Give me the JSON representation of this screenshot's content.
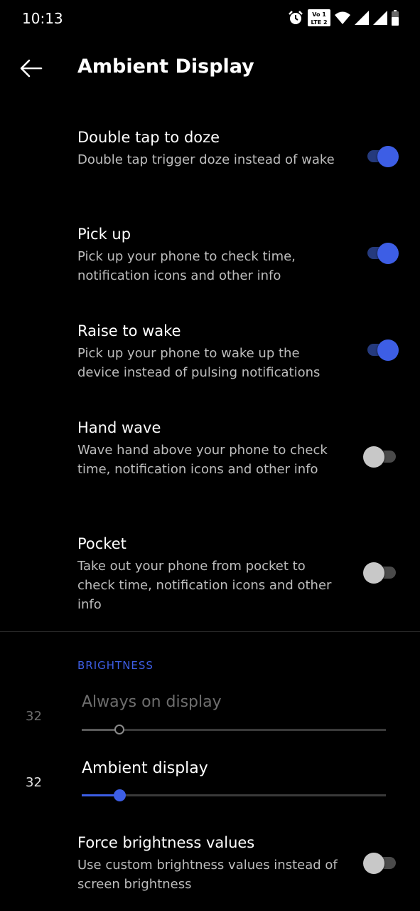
{
  "status_bar": {
    "time": "10:13",
    "icons": [
      "alarm-icon",
      "volte-icon",
      "wifi-icon",
      "signal-icon",
      "signal-icon-2",
      "battery-icon"
    ],
    "volte_text_top": "Vo 1",
    "volte_text_bottom": "LTE 2"
  },
  "header": {
    "title": "Ambient Display",
    "back_icon": "arrow-left-icon"
  },
  "settings": [
    {
      "title": "Double tap to doze",
      "subtitle": "Double tap trigger doze instead of wake",
      "enabled": true
    },
    {
      "title": "Pick up",
      "subtitle": "Pick up your phone to check time, notification icons and other info",
      "enabled": true
    },
    {
      "title": "Raise to wake",
      "subtitle": "Pick up your phone to wake up the device instead of pulsing notifications",
      "enabled": true
    },
    {
      "title": "Hand wave",
      "subtitle": "Wave hand above your phone to check time, notification icons and other info",
      "enabled": false
    },
    {
      "title": "Pocket",
      "subtitle": "Take out your phone from pocket to check time, notification icons and other info",
      "enabled": false
    }
  ],
  "brightness": {
    "section_label": "BRIGHTNESS",
    "always_on": {
      "title": "Always on display",
      "value": "32",
      "level": 0.125,
      "disabled": true
    },
    "ambient": {
      "title": "Ambient display",
      "value": "32",
      "level": 0.125,
      "disabled": false
    },
    "force": {
      "title": "Force brightness values",
      "subtitle": "Use custom brightness values instead of screen brightness",
      "enabled": false
    }
  },
  "colors": {
    "accent": "#3d5ee5",
    "background": "#000000",
    "secondary_text": "#bdbdbd",
    "disabled_text": "#6e6e6e"
  }
}
